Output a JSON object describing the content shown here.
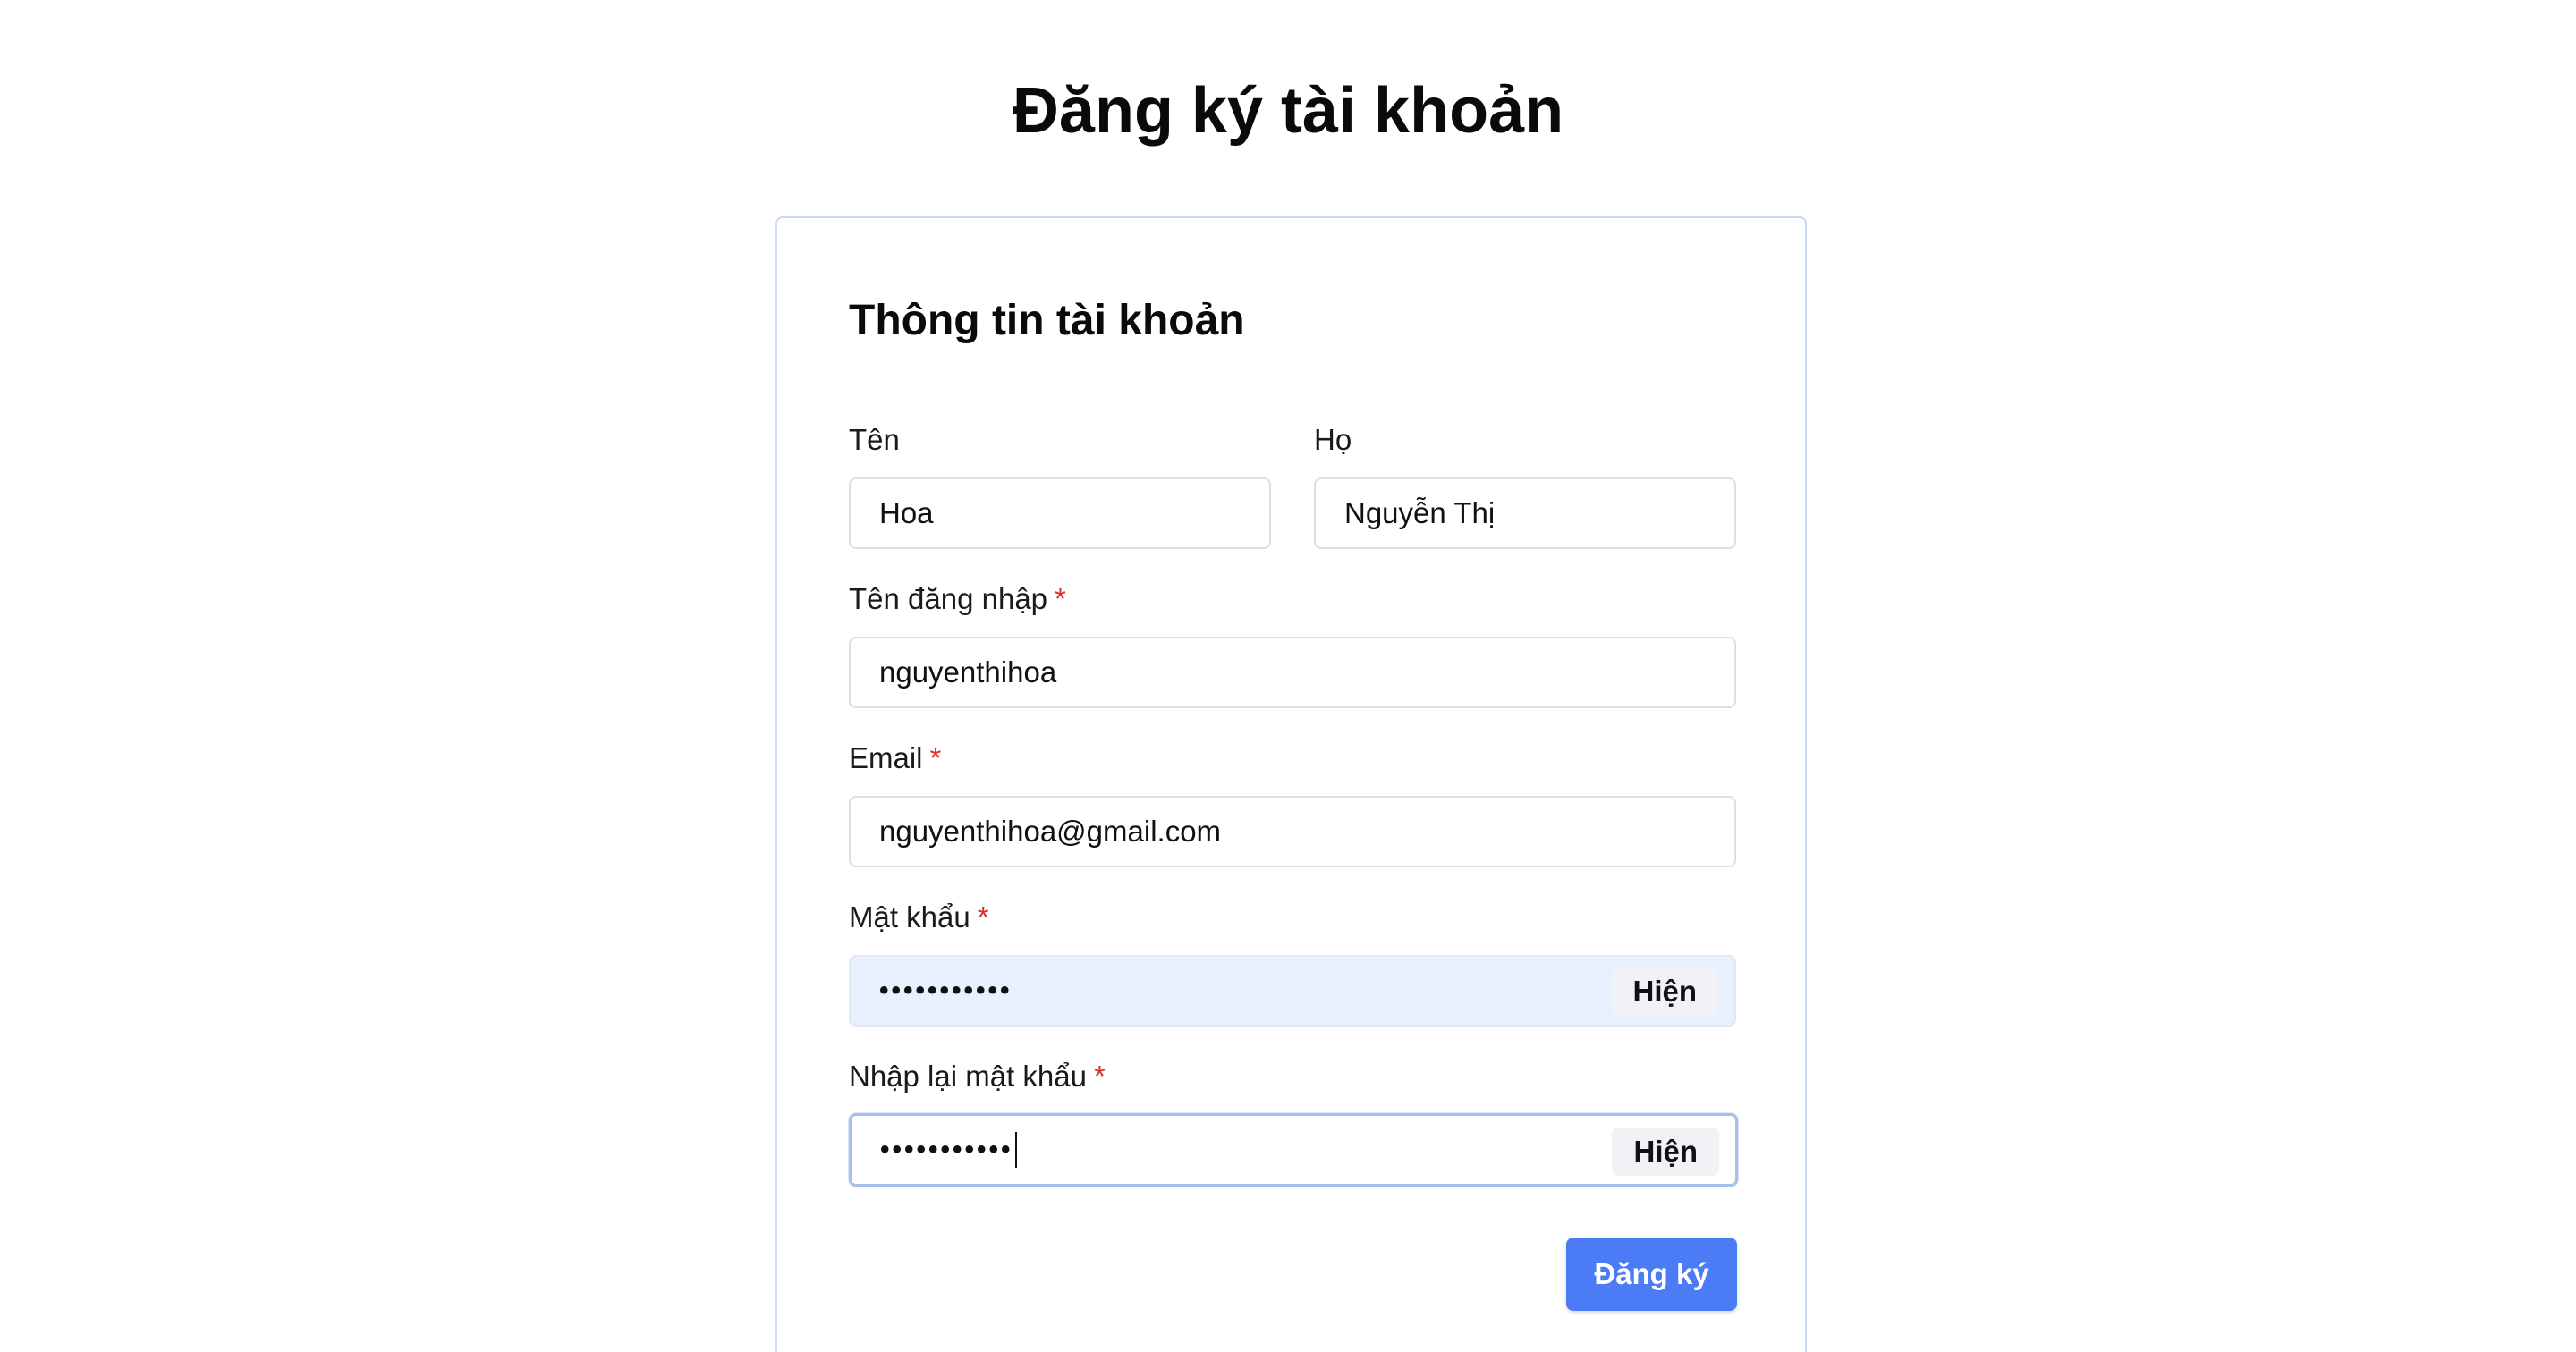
{
  "page": {
    "title": "Đăng ký tài khoản"
  },
  "form": {
    "section_title": "Thông tin tài khoản",
    "first_name": {
      "label": "Tên",
      "value": "Hoa"
    },
    "last_name": {
      "label": "Họ",
      "value": "Nguyễn Thị"
    },
    "username": {
      "label": "Tên đăng nhập",
      "required_mark": "*",
      "value": "nguyenthihoa"
    },
    "email": {
      "label": "Email",
      "required_mark": "*",
      "value": "nguyenthihoa@gmail.com"
    },
    "password": {
      "label": "Mật khẩu",
      "required_mark": "*",
      "masked_value": "•••••••••••",
      "toggle_label": "Hiện"
    },
    "confirm_password": {
      "label": "Nhập lại mật khẩu",
      "required_mark": "*",
      "masked_value": "•••••••••••",
      "toggle_label": "Hiện"
    },
    "submit_label": "Đăng ký"
  },
  "colors": {
    "accent": "#4b7bf5",
    "required": "#d93025",
    "card_border": "#c9daf3",
    "autofill_bg": "#e8f0fd"
  }
}
